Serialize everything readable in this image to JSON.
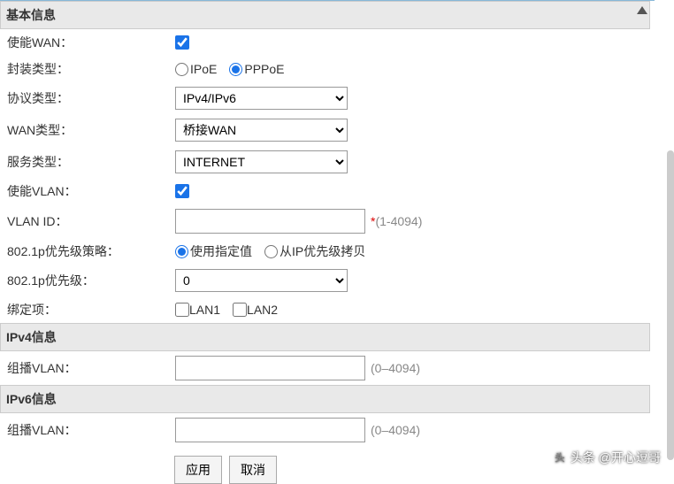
{
  "sections": {
    "basic": "基本信息",
    "ipv4": "IPv4信息",
    "ipv6": "IPv6信息"
  },
  "labels": {
    "enable_wan": "使能WAN：",
    "encapsulation": "封装类型：",
    "protocol": "协议类型：",
    "wan_type": "WAN类型：",
    "service_type": "服务类型：",
    "enable_vlan": "使能VLAN：",
    "vlan_id": "VLAN ID：",
    "priority_policy": "802.1p优先级策略：",
    "priority": "802.1p优先级：",
    "binding": "绑定项：",
    "multicast_vlan_v4": "组播VLAN：",
    "multicast_vlan_v6": "组播VLAN："
  },
  "options": {
    "ipoe": "IPoE",
    "pppoe": "PPPoE",
    "protocol_sel": "IPv4/IPv6",
    "wan_type_sel": "桥接WAN",
    "service_type_sel": "INTERNET",
    "use_specified": "使用指定值",
    "copy_from_ip": "从IP优先级拷贝",
    "priority_sel": "0",
    "lan1": "LAN1",
    "lan2": "LAN2"
  },
  "hints": {
    "vlan_id": "(1-4094)",
    "multicast_v4": "(0–4094)",
    "multicast_v6": "(0–4094)"
  },
  "buttons": {
    "apply": "应用",
    "cancel": "取消"
  },
  "watermark": "头条 @开心逗哥"
}
